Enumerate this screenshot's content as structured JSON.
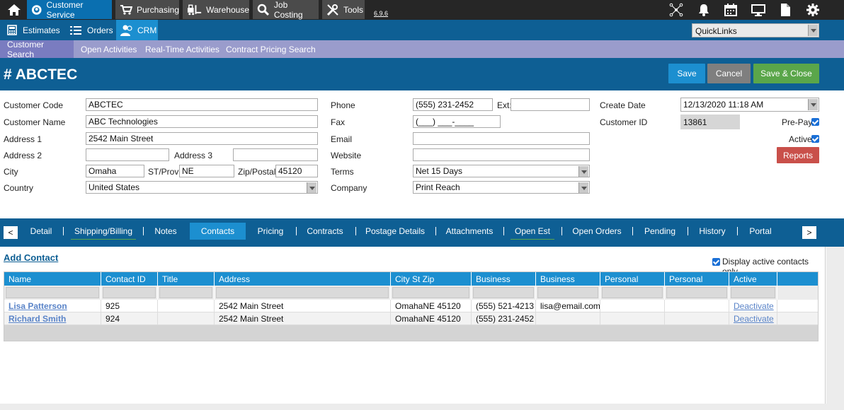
{
  "top_nav": {
    "modules": [
      {
        "label": "Customer Service",
        "icon": "headset-icon"
      },
      {
        "label": "Purchasing",
        "icon": "cart-icon"
      },
      {
        "label": "Warehouse",
        "icon": "forklift-icon"
      },
      {
        "label": "Job Costing",
        "icon": "magnifier-icon"
      },
      {
        "label": "Tools",
        "icon": "wrench-icon"
      }
    ],
    "version": "6.9.6",
    "right_icons": [
      "network-icon",
      "bell-icon",
      "calendar-icon",
      "monitor-icon",
      "document-icon",
      "gear-icon"
    ]
  },
  "sub_nav": {
    "items": [
      {
        "label": "Estimates",
        "icon": "calculator-icon"
      },
      {
        "label": "Orders",
        "icon": "list-icon"
      },
      {
        "label": "CRM",
        "icon": "users-icon"
      }
    ],
    "quicklinks": "QuickLinks"
  },
  "section_nav": {
    "items": [
      "Customer Search",
      "Open Activities",
      "Real-Time Activities",
      "Contract Pricing Search"
    ]
  },
  "header": {
    "title": "# ABCTEC",
    "save": "Save",
    "cancel": "Cancel",
    "save_close": "Save & Close"
  },
  "form": {
    "customer_code": {
      "label": "Customer Code",
      "value": "ABCTEC"
    },
    "customer_name": {
      "label": "Customer Name",
      "value": "ABC Technologies"
    },
    "address1": {
      "label": "Address 1",
      "value": "2542 Main Street"
    },
    "address2": {
      "label": "Address 2",
      "value": ""
    },
    "address3": {
      "label": "Address 3",
      "value": ""
    },
    "city": {
      "label": "City",
      "value": "Omaha"
    },
    "state": {
      "label": "ST/Prov",
      "value": "NE"
    },
    "zip": {
      "label": "Zip/Postal",
      "value": "45120"
    },
    "country": {
      "label": "Country",
      "value": "United States"
    },
    "phone": {
      "label": "Phone",
      "value": "(555) 231-2452"
    },
    "ext": {
      "label": "Ext:",
      "value": ""
    },
    "fax": {
      "label": "Fax",
      "value": "(___) ___-____"
    },
    "email": {
      "label": "Email",
      "value": ""
    },
    "website": {
      "label": "Website",
      "value": ""
    },
    "terms": {
      "label": "Terms",
      "value": "Net 15 Days"
    },
    "company": {
      "label": "Company",
      "value": "Print Reach"
    },
    "create_date": {
      "label": "Create Date",
      "value": "12/13/2020 11:18 AM"
    },
    "customer_id": {
      "label": "Customer ID",
      "value": "13861"
    },
    "prepay": {
      "label": "Pre-Pay",
      "checked": true
    },
    "active": {
      "label": "Active",
      "checked": true
    },
    "reports": "Reports"
  },
  "tabs": {
    "prev": "<",
    "next": ">",
    "items": [
      "Detail",
      "Shipping/Billing",
      "Notes",
      "Contacts",
      "Pricing",
      "Contracts",
      "Postage Details",
      "Attachments",
      "Open Est",
      "Open Orders",
      "Pending",
      "History",
      "Portal"
    ],
    "selected": "Contacts"
  },
  "contacts": {
    "add_label": "Add Contact",
    "filter_label": "Display active contacts only",
    "filter_checked": true,
    "columns": [
      "Name",
      "Contact ID",
      "Title",
      "Address",
      "City St Zip",
      "Business Phone",
      "Business Email",
      "Personal Phone",
      "Personal Email",
      "Active"
    ],
    "rows": [
      {
        "name": "Lisa Patterson",
        "contact_id": "925",
        "title": "",
        "address": "2542 Main Street",
        "city_st_zip": "OmahaNE 45120",
        "business_phone": "(555) 521-4213",
        "business_email": "lisa@email.com",
        "personal_phone": "",
        "personal_email": "",
        "active": "Deactivate"
      },
      {
        "name": "Richard Smith",
        "contact_id": "924",
        "title": "",
        "address": "2542 Main Street",
        "city_st_zip": "OmahaNE 45120",
        "business_phone": "(555) 231-2452",
        "business_email": "",
        "personal_phone": "",
        "personal_email": "",
        "active": "Deactivate"
      }
    ]
  },
  "colors": {
    "dark": "#262626",
    "primary": "#0e5f94",
    "accent": "#1c8fd0",
    "lavender": "#9a9ccc",
    "save": "#1c8fd0",
    "cancel": "#7f7f7f",
    "save_close": "#5aa64a",
    "reports": "#c9504a"
  }
}
